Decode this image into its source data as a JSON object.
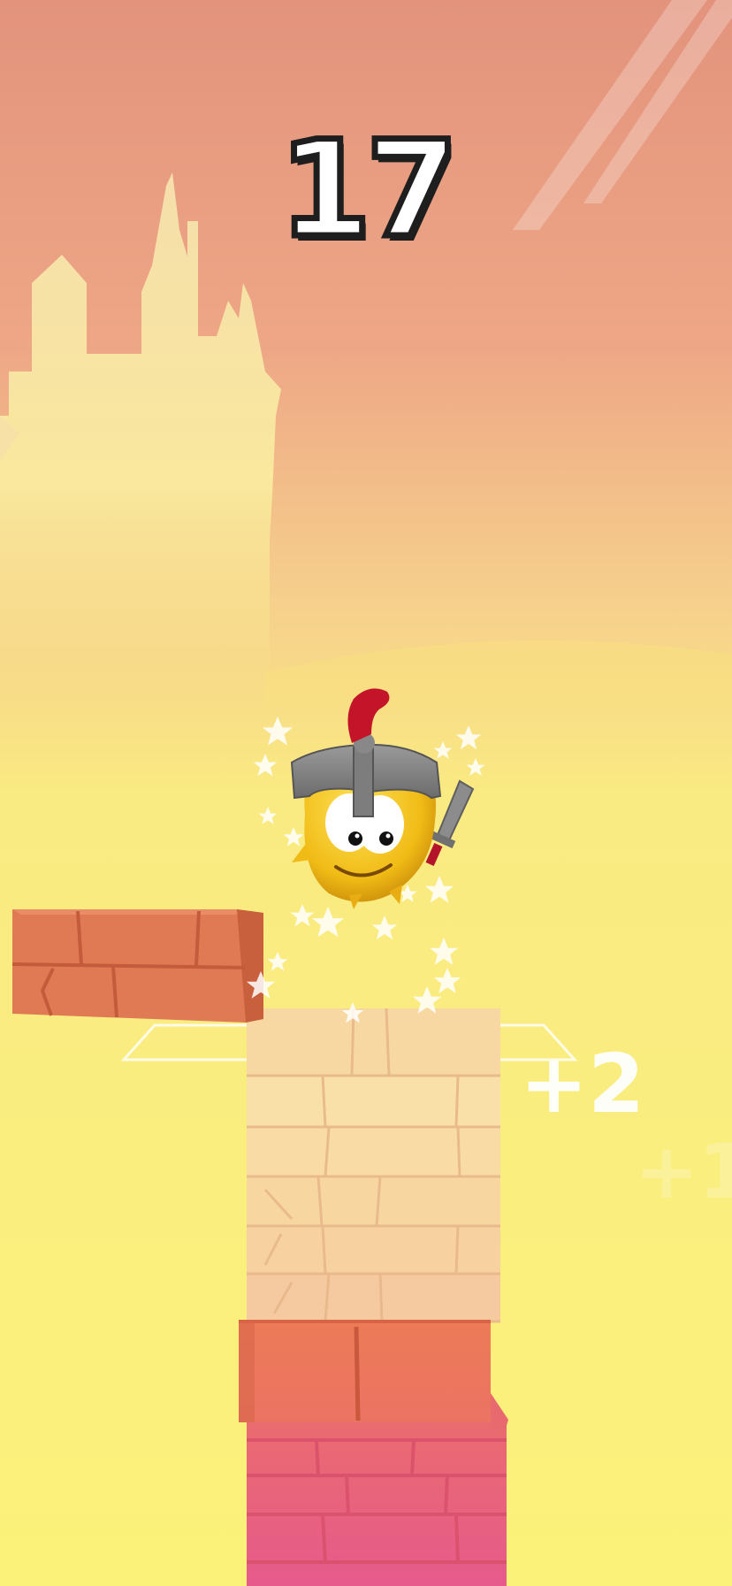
{
  "hud": {
    "score": "17"
  },
  "effects": {
    "bonus_main": "+2",
    "bonus_faded": "+1"
  },
  "colors": {
    "sky_top": "#e3937c",
    "sky_mid": "#f0b88d",
    "sky_bottom": "#faf27c",
    "castle": "#faf0a5",
    "sliding_brick": "#e07752",
    "stack_top": "#f9d79a",
    "stack_mid": "#ec7c5c",
    "stack_bottom": "#e85f87",
    "helmet": "#8a8a8a",
    "plume": "#c3142a",
    "character_body": "#f2c41c"
  },
  "icons": [
    "castle-silhouette",
    "star-sparkle",
    "knight-character",
    "sword-icon",
    "brick-block"
  ]
}
